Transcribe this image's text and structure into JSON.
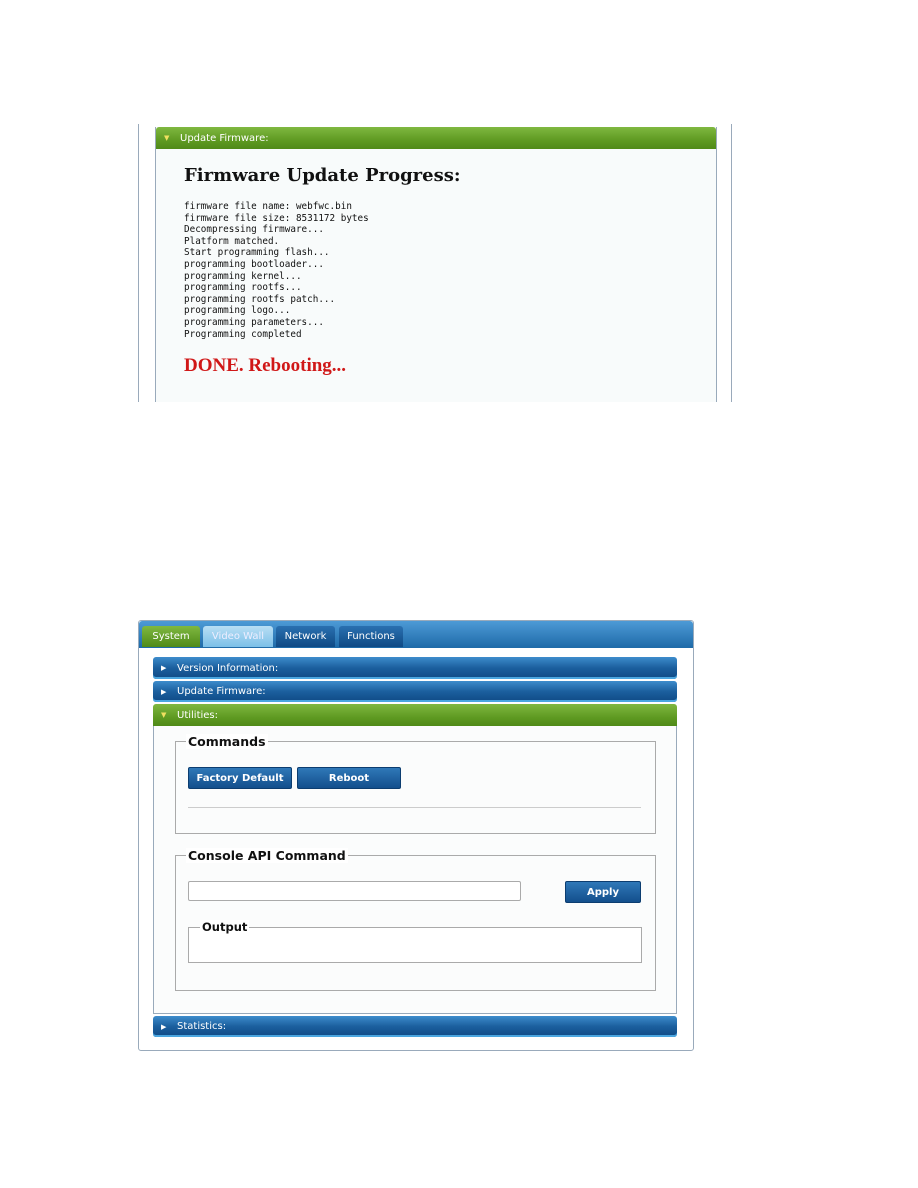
{
  "firmware_panel": {
    "header": "Update Firmware:",
    "title": "Firmware Update Progress:",
    "log": [
      "firmware file name: webfwc.bin",
      "firmware file size: 8531172 bytes",
      "Decompressing firmware...",
      "Platform matched.",
      "Start programming flash...",
      "programming bootloader...",
      "programming kernel...",
      "programming rootfs...",
      "programming rootfs patch...",
      "programming logo...",
      "programming parameters...",
      "Programming completed"
    ],
    "status": "DONE. Rebooting...",
    "status_color": "#d01818"
  },
  "system_panel": {
    "tabs": [
      "System",
      "Video Wall",
      "Network",
      "Functions"
    ],
    "active_tab": "System",
    "sections": {
      "version": "Version Information:",
      "update": "Update Firmware:",
      "utilities": "Utilities:",
      "statistics": "Statistics:"
    },
    "commands": {
      "legend": "Commands",
      "factory_default": "Factory Default",
      "reboot": "Reboot"
    },
    "console": {
      "legend": "Console API Command",
      "input_value": "",
      "apply": "Apply",
      "output_legend": "Output",
      "output_value": ""
    }
  },
  "colors": {
    "green": "#5f9a22",
    "blue": "#1b5f9e"
  }
}
